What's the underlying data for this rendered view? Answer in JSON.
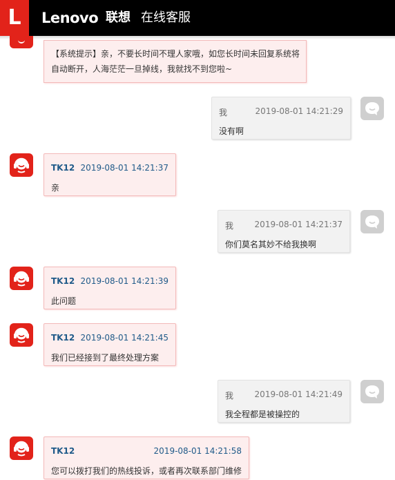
{
  "header": {
    "logo_letter": "L",
    "brand": "Lenovo",
    "brand_cn": "联想",
    "subtitle": "在线客服"
  },
  "system_message": "【系统提示】亲，不要长时间不理人家哦，如您长时间未回复系统将自动断开，人海茫茫一旦掉线，我就找不到您啦~",
  "messages": [
    {
      "sender": "我",
      "time": "2019-08-01 14:21:29",
      "text": "没有啊"
    },
    {
      "sender": "TK12",
      "time": "2019-08-01 14:21:37",
      "text": "亲"
    },
    {
      "sender": "我",
      "time": "2019-08-01 14:21:37",
      "text": "你们莫名其妙不给我换啊"
    },
    {
      "sender": "TK12",
      "time": "2019-08-01 14:21:39",
      "text": "此问题"
    },
    {
      "sender": "TK12",
      "time": "2019-08-01 14:21:45",
      "text": "我们已经接到了最终处理方案"
    },
    {
      "sender": "我",
      "time": "2019-08-01 14:21:49",
      "text": "我全程都是被操控的"
    },
    {
      "sender": "TK12",
      "time": "2019-08-01 14:21:58",
      "text": "您可以拨打我们的热线投诉，或者再次联系部门维修"
    }
  ],
  "colors": {
    "brand_red": "#e2231a",
    "header_bg": "#000000",
    "agent_bubble": "#fdeeee",
    "user_bubble": "#f2f2f2",
    "agent_name": "#1f5a89"
  },
  "icons": {
    "agent_avatar": "headset-agent-icon",
    "user_avatar": "user-chat-bubble-icon"
  }
}
